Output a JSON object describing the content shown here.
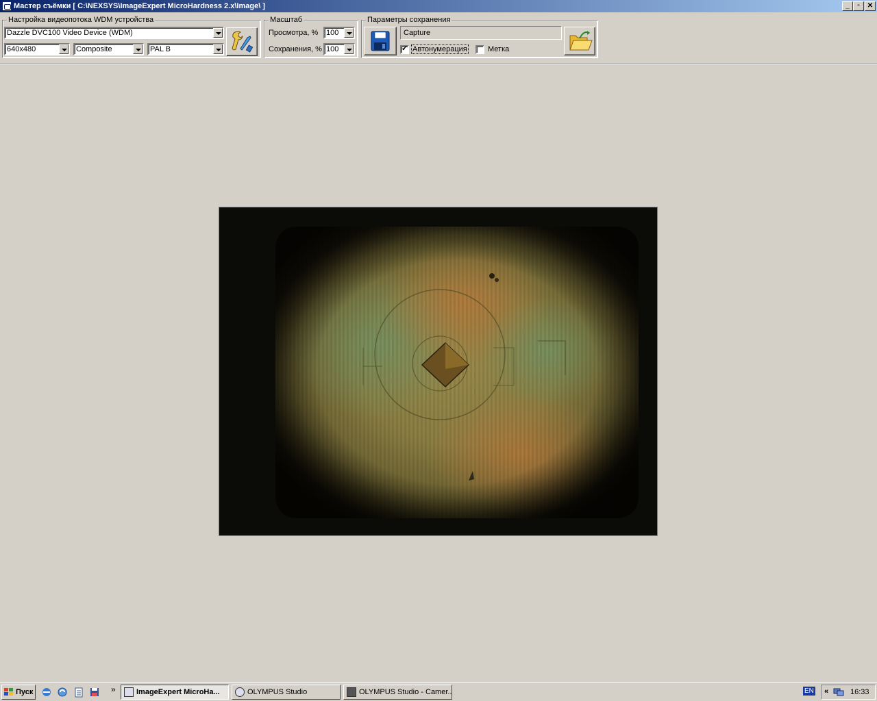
{
  "window": {
    "title": "Мастер съёмки [ C:\\NEXSYS\\ImageExpert MicroHardness 2.x\\Image\\ ]",
    "minimize": "_",
    "maximize": "▫",
    "close": "✕"
  },
  "wdm_group": {
    "label": "Настройка видеопотока WDM устройства",
    "device": "Dazzle DVC100 Video Device (WDM)",
    "resolution": "640x480",
    "input": "Composite",
    "standard": "PAL B",
    "settings_icon": "wrench-screwdriver-icon"
  },
  "scale_group": {
    "label": "Масштаб",
    "preview_label": "Просмотра,  %",
    "preview_value": "100",
    "save_label": "Сохранения,  %",
    "save_value": "100"
  },
  "save_group": {
    "label": "Параметры сохранения",
    "filename": "Capture",
    "autonumber_label": "Автонумерация",
    "autonumber_checked": true,
    "mark_label": "Метка",
    "mark_checked": false,
    "save_icon": "floppy-disk-icon",
    "folder_icon": "open-folder-icon"
  },
  "taskbar": {
    "start_label": "Пуск",
    "chevron": "»",
    "tasks": [
      {
        "label": "ImageExpert MicroHa...",
        "active": true
      },
      {
        "label": "OLYMPUS Studio",
        "active": false
      },
      {
        "label": "OLYMPUS Studio - Camer...",
        "active": false
      }
    ],
    "lang": "EN",
    "tray_chevron": "«",
    "clock": "16:33"
  }
}
